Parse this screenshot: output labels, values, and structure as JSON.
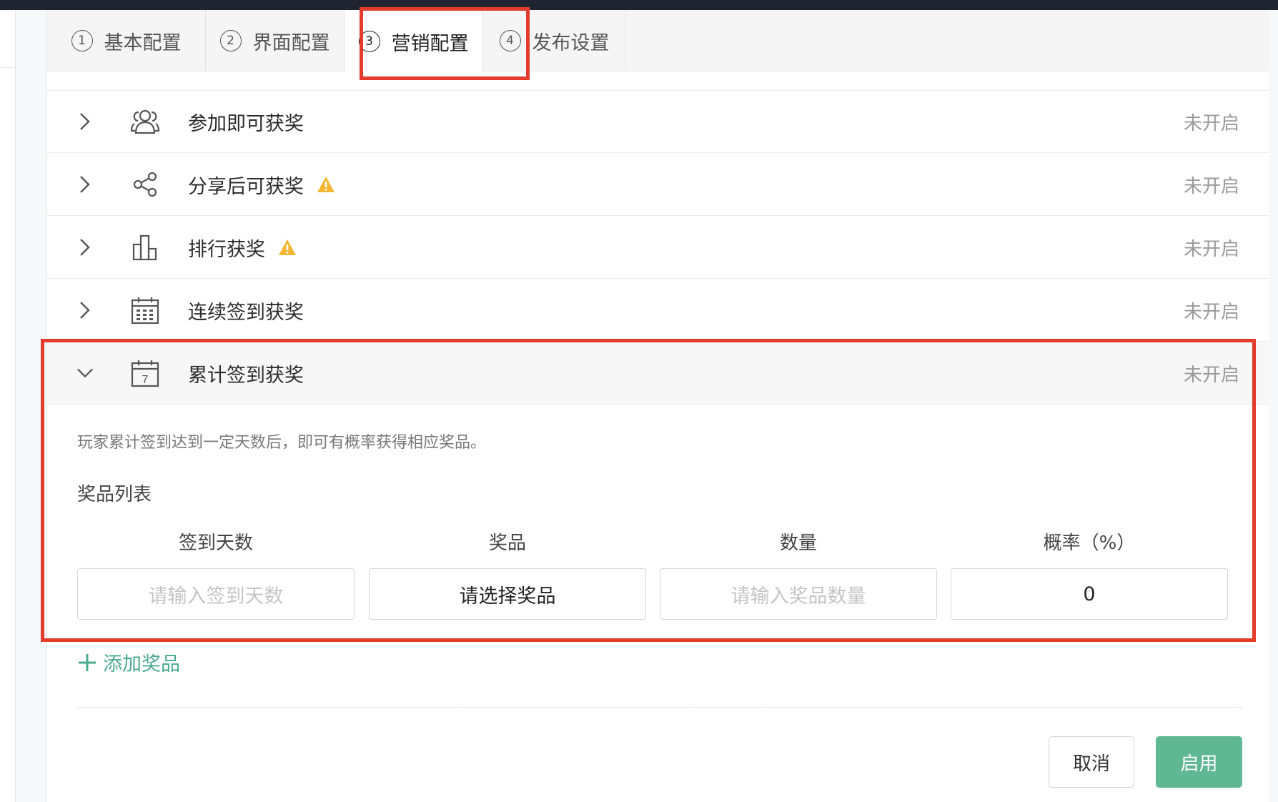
{
  "tabs": [
    {
      "num": "1",
      "label": "基本配置"
    },
    {
      "num": "2",
      "label": "界面配置"
    },
    {
      "num": "3",
      "label": "营销配置"
    },
    {
      "num": "4",
      "label": "发布设置"
    }
  ],
  "rows": [
    {
      "title": "参加即可获奖",
      "status": "未开启",
      "icon": "users-icon",
      "warning": false
    },
    {
      "title": "分享后可获奖",
      "status": "未开启",
      "icon": "share-icon",
      "warning": true
    },
    {
      "title": "排行获奖",
      "status": "未开启",
      "icon": "ranking-icon",
      "warning": true
    },
    {
      "title": "连续签到获奖",
      "status": "未开启",
      "icon": "calendar-icon",
      "warning": false
    },
    {
      "title": "累计签到获奖",
      "status": "未开启",
      "icon": "calendar-7-icon",
      "warning": false
    }
  ],
  "expanded": {
    "description": "玩家累计签到达到一定天数后，即可有概率获得相应奖品。",
    "prize_list_title": "奖品列表",
    "columns": [
      "签到天数",
      "奖品",
      "数量",
      "概率（%）"
    ],
    "fields": {
      "days_placeholder": "请输入签到天数",
      "prize_value": "请选择奖品",
      "quantity_placeholder": "请输入奖品数量",
      "probability_value": "0"
    },
    "add_label": "添加奖品",
    "cancel_label": "取消",
    "enable_label": "启用",
    "calendar_day": "7"
  },
  "colors": {
    "accent_green": "#5fb793",
    "highlight_red": "#e33b2c",
    "warning_yellow": "#f5b731"
  }
}
